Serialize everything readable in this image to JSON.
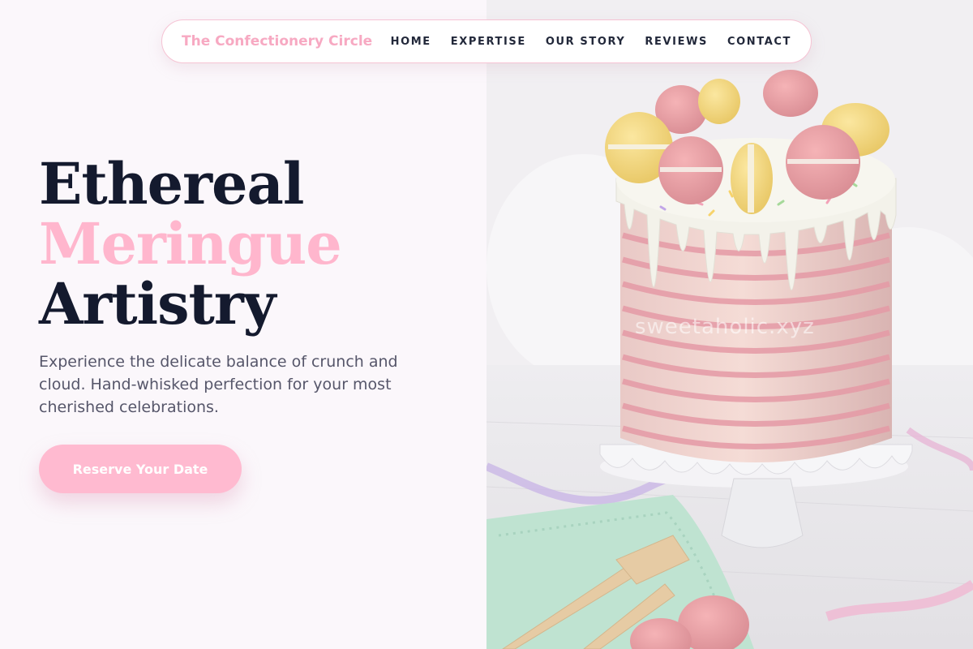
{
  "nav": {
    "brand": "The Confectionery Circle",
    "links": [
      "HOME",
      "EXPERTISE",
      "OUR STORY",
      "REVIEWS",
      "CONTACT"
    ]
  },
  "hero": {
    "title_line1": "Ethereal",
    "title_line2": "Meringue",
    "title_line3": "Artistry",
    "description": "Experience the delicate balance of crunch and cloud. Hand-whisked perfection for your most cherished celebrations.",
    "cta_label": "Reserve Your Date"
  },
  "photo": {
    "watermark": "sweetaholic.xyz"
  },
  "colors": {
    "accent_pink": "#ffb6cd",
    "brand_pink": "#f7a9c2",
    "dark_text": "#141a2e",
    "background": "#fbf7fb"
  }
}
